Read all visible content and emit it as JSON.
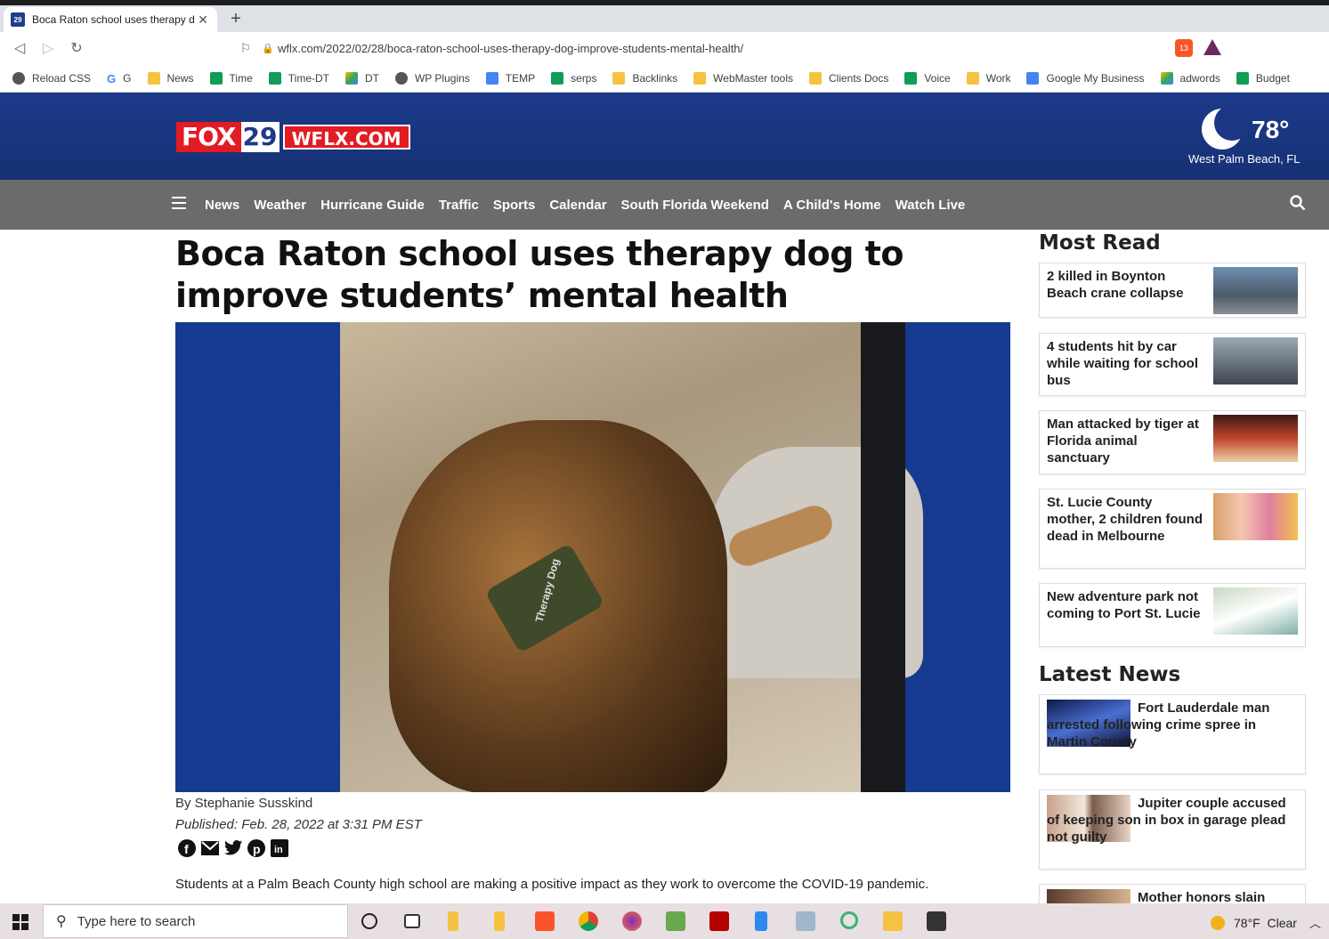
{
  "browser": {
    "tab_title": "Boca Raton school uses therapy d",
    "tab_favicon_text": "29",
    "url": "wflx.com/2022/02/28/boca-raton-school-uses-therapy-dog-improve-students-mental-health/",
    "extension_badge": "13"
  },
  "bookmarks": [
    {
      "label": "Reload CSS",
      "icon": "globe-icon"
    },
    {
      "label": "G",
      "icon": "google-icon"
    },
    {
      "label": "News",
      "icon": "folder-icon"
    },
    {
      "label": "Time",
      "icon": "plus-sheet-icon"
    },
    {
      "label": "Time-DT",
      "icon": "plus-sheet-icon"
    },
    {
      "label": "DT",
      "icon": "drive-icon"
    },
    {
      "label": "WP Plugins",
      "icon": "globe-icon"
    },
    {
      "label": "TEMP",
      "icon": "doc-icon"
    },
    {
      "label": "serps",
      "icon": "plus-sheet-icon"
    },
    {
      "label": "Backlinks",
      "icon": "folder-icon"
    },
    {
      "label": "WebMaster tools",
      "icon": "folder-icon"
    },
    {
      "label": "Clients Docs",
      "icon": "folder-icon"
    },
    {
      "label": "Voice",
      "icon": "phone-icon"
    },
    {
      "label": "Work",
      "icon": "folder-icon"
    },
    {
      "label": "Google My Business",
      "icon": "gmb-icon"
    },
    {
      "label": "adwords",
      "icon": "ads-icon"
    },
    {
      "label": "Budget",
      "icon": "plus-sheet-icon"
    }
  ],
  "site": {
    "logo_fox": "FOX",
    "logo_num": "29",
    "logo_domain": "WFLX.COM",
    "weather_temp": "78°",
    "weather_location": "West Palm Beach, FL",
    "nav": [
      "News",
      "Weather",
      "Hurricane Guide",
      "Traffic",
      "Sports",
      "Calendar",
      "South Florida Weekend",
      "A Child's Home",
      "Watch Live"
    ]
  },
  "article": {
    "headline": "Boca Raton school uses therapy dog to improve students’ mental health",
    "byline": "By Stephanie Susskind",
    "published": "Published: Feb. 28, 2022 at 3:31 PM EST",
    "collar_text": "Therapy Dog",
    "body_first": "Students at a Palm Beach County high school are making a positive impact as they work to overcome the COVID-19 pandemic."
  },
  "sidebar": {
    "most_read_title": "Most Read",
    "most_read": [
      "2 killed in Boynton Beach crane collapse",
      "4 students hit by car while waiting for school bus",
      "Man attacked by tiger at Florida animal sanctuary",
      "St. Lucie County mother, 2 children found dead in Melbourne",
      "New adventure park not coming to Port St. Lucie"
    ],
    "latest_title": "Latest News",
    "latest": [
      "Fort Lauderdale man arrested following crime spree in Martin County",
      "Jupiter couple accused of keeping son in box in garage plead not guilty",
      "Mother honors slain"
    ]
  },
  "taskbar": {
    "search_placeholder": "Type here to search",
    "weather": "78°F  Clear"
  }
}
